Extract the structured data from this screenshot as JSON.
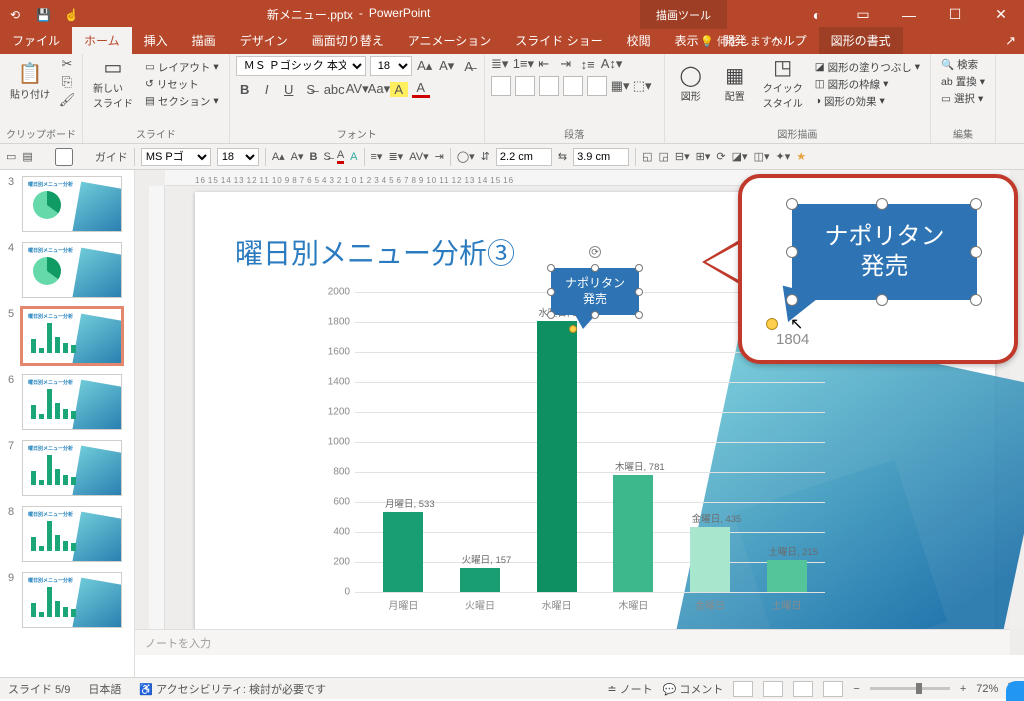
{
  "title": {
    "doc": "新メニュー.pptx",
    "app": "PowerPoint",
    "context_tab": "描画ツール"
  },
  "win": {
    "account": "◐",
    "opts": "▭",
    "min": "—",
    "max": "☐",
    "close": "✕"
  },
  "tabs": [
    "ファイル",
    "ホーム",
    "挿入",
    "描画",
    "デザイン",
    "画面切り替え",
    "アニメーション",
    "スライド ショー",
    "校閲",
    "表示",
    "開発",
    "ヘルプ",
    "図形の書式"
  ],
  "active_tab": 1,
  "context_idx": 12,
  "tell_me": "何をしますか",
  "ribbon": {
    "clipboard": {
      "paste": "貼り付け",
      "label": "クリップボード"
    },
    "slides": {
      "new": "新しい\nスライド",
      "layout": "レイアウト",
      "reset": "リセット",
      "section": "セクション",
      "label": "スライド"
    },
    "font": {
      "family": "ＭＳ Ｐゴシック 本文",
      "size": "18",
      "label": "フォント"
    },
    "para": {
      "label": "段落"
    },
    "drawing": {
      "shapes": "図形",
      "arrange": "配置",
      "quick": "クイック\nスタイル",
      "fill": "図形の塗りつぶし",
      "outline": "図形の枠線",
      "effects": "図形の効果",
      "label": "図形描画"
    },
    "editing": {
      "find": "検索",
      "replace": "置換",
      "select": "選択",
      "label": "編集"
    }
  },
  "subbar": {
    "guide": "ガイド",
    "font": "MS  Pゴ",
    "size": "18",
    "height_lbl": "",
    "height": "2.2 cm",
    "width": "3.9 cm"
  },
  "ruler_marks": [
    "16",
    "15",
    "14",
    "13",
    "12",
    "11",
    "10",
    "9",
    "8",
    "7",
    "6",
    "5",
    "4",
    "3",
    "2",
    "1",
    "0",
    "1",
    "2",
    "3",
    "4",
    "5",
    "6",
    "7",
    "8",
    "9",
    "10",
    "11",
    "12",
    "13",
    "14",
    "15",
    "16"
  ],
  "thumbs": {
    "visible": [
      3,
      4,
      5,
      6,
      7,
      8,
      9
    ],
    "selected": 5
  },
  "slide": {
    "title": "曜日別メニュー分析③",
    "callout_line1": "ナポリタン",
    "callout_line2": "発売"
  },
  "chart_data": {
    "type": "bar",
    "title": "",
    "xlabel": "",
    "ylabel": "",
    "ylim": [
      0,
      2000
    ],
    "yticks": [
      0,
      200,
      400,
      600,
      800,
      1000,
      1200,
      1400,
      1600,
      1800,
      2000
    ],
    "categories": [
      "月曜日",
      "火曜日",
      "水曜日",
      "木曜日",
      "金曜日",
      "土曜日"
    ],
    "series": [
      {
        "name": "",
        "values": [
          533,
          157,
          1804,
          781,
          435,
          215
        ]
      }
    ],
    "data_labels": [
      "月曜日, 533",
      "火曜日, 157",
      "水曜日, 1804",
      "木曜日, 781",
      "金曜日, 435",
      "土曜日, 215"
    ],
    "colors": [
      "#199e73",
      "#199e73",
      "#0f9063",
      "#3db88d",
      "#a9e6ce",
      "#54c49b"
    ]
  },
  "zoom_overlay": {
    "line1": "ナポリタン",
    "line2": "発売",
    "value": "1804"
  },
  "notes_placeholder": "ノートを入力",
  "status": {
    "slide": "スライド 5/9",
    "lang": "日本語",
    "a11y": "アクセシビリティ: 検討が必要です",
    "notes": "ノート",
    "comments": "コメント",
    "zoom": "72%"
  }
}
